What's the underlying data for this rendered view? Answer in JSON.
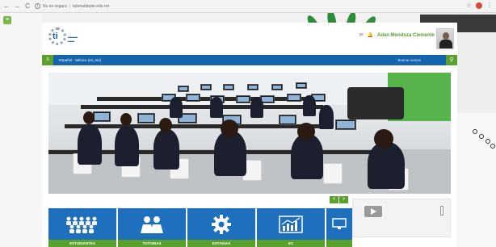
{
  "browser": {
    "url_security": "No es seguro",
    "url": "tutoriaIdepte.edu.mx",
    "nav": {
      "back": "←",
      "forward": "→",
      "reload": "C"
    }
  },
  "site": {
    "user_name": "Adan Mendoza Clemente",
    "language": "Español - México (es_mx)",
    "search_placeholder": "Buscar cursos",
    "tiles": [
      {
        "label": "ESTUDIANTES",
        "icon": "group-icon"
      },
      {
        "label": "TUTORIAS",
        "icon": "people-icon"
      },
      {
        "label": "ESTADIAS",
        "icon": "gear-icon"
      },
      {
        "label": "EX",
        "icon": "chart-icon"
      },
      {
        "label": "",
        "icon": "monitor-icon"
      }
    ],
    "slider_prev": "<",
    "slider_next": ">"
  },
  "colors": {
    "brand_blue": "#1464ae",
    "brand_green": "#5aa02c",
    "tile_blue": "#1f6fbf"
  }
}
